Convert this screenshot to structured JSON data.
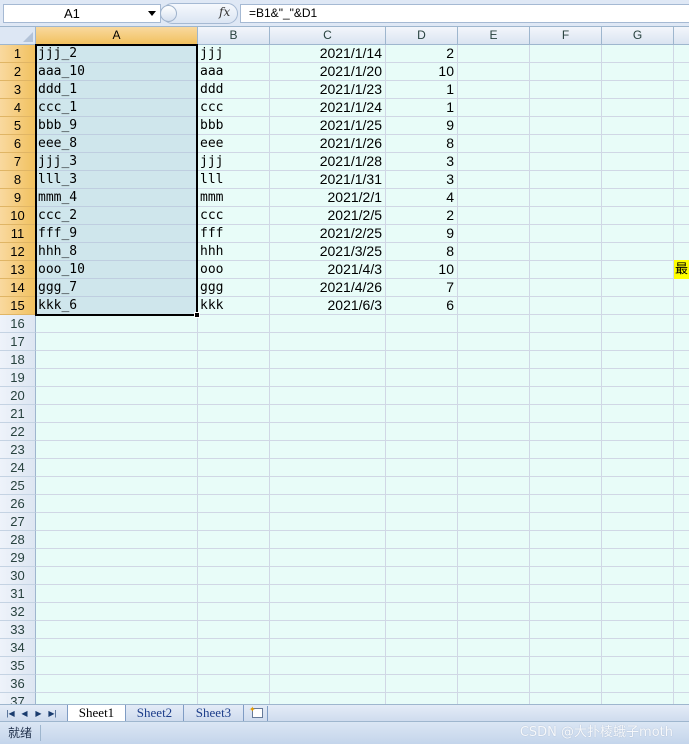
{
  "formula_bar": {
    "name_box": "A1",
    "fx_symbol": "fx",
    "formula": "=B1&\"_\"&D1"
  },
  "columns": [
    "A",
    "B",
    "C",
    "D",
    "E",
    "F",
    "G"
  ],
  "active_column": "A",
  "row_numbers": [
    "1",
    "2",
    "3",
    "4",
    "5",
    "6",
    "7",
    "8",
    "9",
    "10",
    "11",
    "12",
    "13",
    "14",
    "15",
    "16",
    "17",
    "18",
    "19",
    "20",
    "21",
    "22",
    "23",
    "24",
    "25",
    "26",
    "27",
    "28",
    "29",
    "30",
    "31",
    "32",
    "33",
    "34",
    "35",
    "36",
    "37"
  ],
  "rows": [
    {
      "a": "jjj_2",
      "b": "jjj",
      "c": "2021/1/14",
      "d": "2"
    },
    {
      "a": "aaa_10",
      "b": "aaa",
      "c": "2021/1/20",
      "d": "10"
    },
    {
      "a": "ddd_1",
      "b": "ddd",
      "c": "2021/1/23",
      "d": "1"
    },
    {
      "a": "ccc_1",
      "b": "ccc",
      "c": "2021/1/24",
      "d": "1"
    },
    {
      "a": "bbb_9",
      "b": "bbb",
      "c": "2021/1/25",
      "d": "9"
    },
    {
      "a": "eee_8",
      "b": "eee",
      "c": "2021/1/26",
      "d": "8"
    },
    {
      "a": "jjj_3",
      "b": "jjj",
      "c": "2021/1/28",
      "d": "3"
    },
    {
      "a": "lll_3",
      "b": "lll",
      "c": "2021/1/31",
      "d": "3"
    },
    {
      "a": "mmm_4",
      "b": "mmm",
      "c": "2021/2/1",
      "d": "4"
    },
    {
      "a": "ccc_2",
      "b": "ccc",
      "c": "2021/2/5",
      "d": "2"
    },
    {
      "a": "fff_9",
      "b": "fff",
      "c": "2021/2/25",
      "d": "9"
    },
    {
      "a": "hhh_8",
      "b": "hhh",
      "c": "2021/3/25",
      "d": "8"
    },
    {
      "a": "ooo_10",
      "b": "ooo",
      "c": "2021/4/3",
      "d": "10"
    },
    {
      "a": "ggg_7",
      "b": "ggg",
      "c": "2021/4/26",
      "d": "7"
    },
    {
      "a": "kkk_6",
      "b": "kkk",
      "c": "2021/6/3",
      "d": "6"
    }
  ],
  "edge_tag": "最",
  "sheet_tabs": [
    "Sheet1",
    "Sheet2",
    "Sheet3"
  ],
  "active_sheet": "Sheet1",
  "status": {
    "ready": "就绪",
    "watermark": "CSDN @大扑棱蛾子moth"
  }
}
